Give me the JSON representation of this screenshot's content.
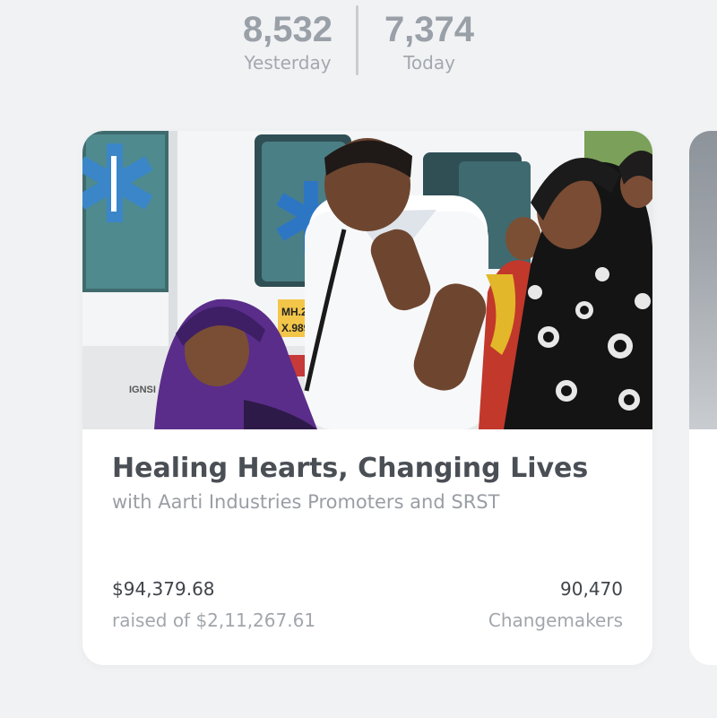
{
  "stats": {
    "yesterday": {
      "value": "8,532",
      "label": "Yesterday"
    },
    "today": {
      "value": "7,374",
      "label": "Today"
    }
  },
  "campaign": {
    "title": "Healing Hearts, Changing Lives",
    "subtitle": "with Aarti Industries Promoters and SRST",
    "raised_amount": "$94,379.68",
    "raised_of": "raised of $2,11,267.61",
    "changemakers_count": "90,470",
    "changemakers_label": "Changemakers",
    "photo_plate_text": "MH.2\nX.989",
    "photo_badge_text": "IGNSI"
  },
  "colors": {
    "page_bg": "#f1f2f4",
    "card_bg": "#ffffff",
    "stat_number": "#9aa0a8",
    "title_text": "#4a4f55",
    "muted_text": "#9a9ea4"
  }
}
